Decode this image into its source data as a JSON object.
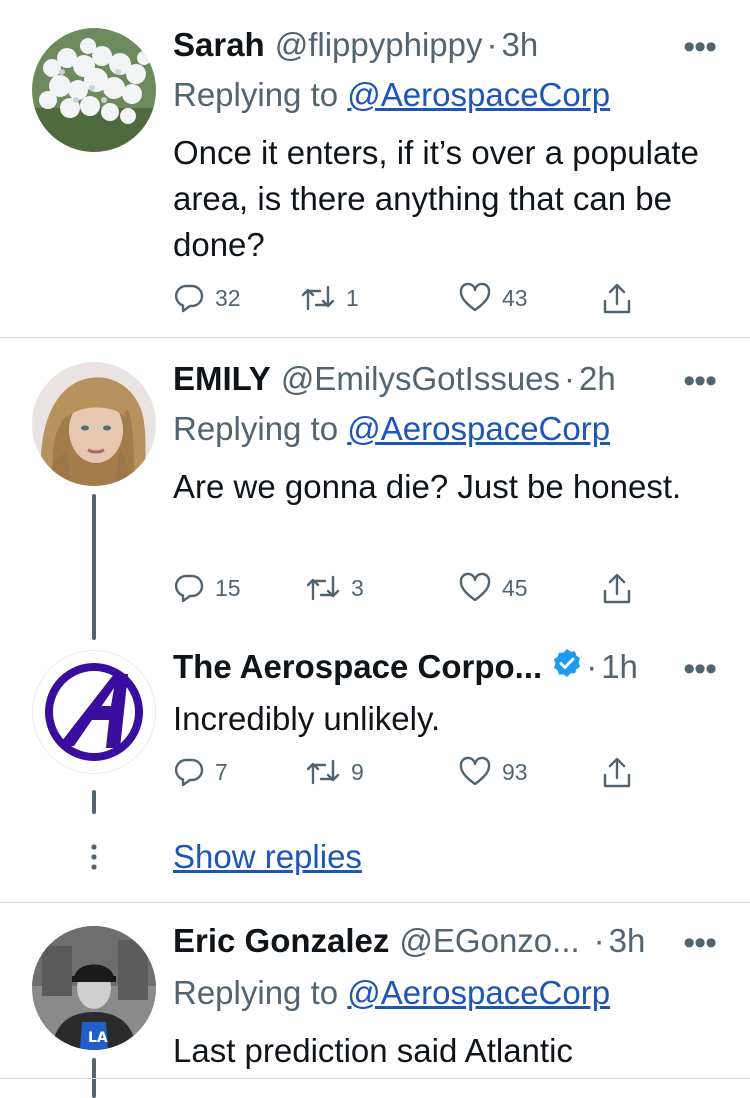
{
  "tweets": [
    {
      "name": "Sarah",
      "handle": "@flippyphippy",
      "time": "3h",
      "replying_label": "Replying to",
      "replying_handle": "@AerospaceCorp",
      "text": "Once it enters, if it’s over a populate area, is there anything that can be done?",
      "replies": "32",
      "retweets": "1",
      "likes": "43"
    },
    {
      "name": "EMILY",
      "handle": "@EmilysGotIssues",
      "time": "2h",
      "replying_label": "Replying to",
      "replying_handle": "@AerospaceCorp",
      "text": "Are we gonna die? Just be honest.",
      "replies": "15",
      "retweets": "3",
      "likes": "45"
    },
    {
      "name": "The Aerospace Corpo...",
      "time": "1h",
      "text": "Incredibly unlikely.",
      "replies": "7",
      "retweets": "9",
      "likes": "93",
      "verified": true
    },
    {
      "name": "Eric Gonzalez",
      "handle": "@EGonzo...",
      "time": "3h",
      "replying_label": "Replying to",
      "replying_handle": "@AerospaceCorp",
      "text": "Last prediction said Atlantic"
    }
  ],
  "show_replies": "Show replies",
  "colors": {
    "link": "#1d55b8",
    "muted": "#536471",
    "verified": "#1d9bf0",
    "aerospace_purple": "#3a0d9e"
  }
}
